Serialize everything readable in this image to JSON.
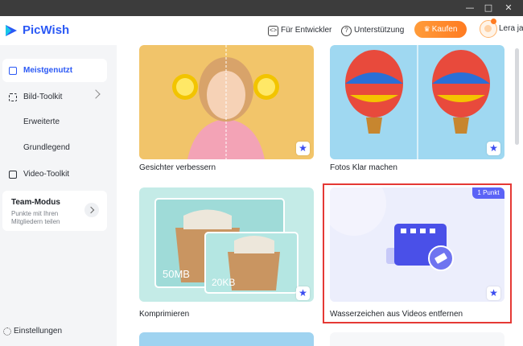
{
  "window": {
    "minimize": "—",
    "maximize": "□",
    "close": "✕"
  },
  "header": {
    "brand": "PicWish",
    "developer_link": "Für Entwickler",
    "support_link": "Unterstützung",
    "buy_button": "Kaufen",
    "username": "Lera ja"
  },
  "sidebar": {
    "items": [
      {
        "label": "Meistgenutzt",
        "active": true
      },
      {
        "label": "Bild-Toolkit"
      },
      {
        "label": "Erweiterte"
      },
      {
        "label": "Grundlegend"
      },
      {
        "label": "Video-Toolkit"
      }
    ],
    "team": {
      "title": "Team-Modus",
      "description": "Punkte mit Ihren Mitgliedern teilen"
    },
    "settings": "Einstellungen"
  },
  "cards": [
    {
      "label": "Gesichter verbessern"
    },
    {
      "label": "Fotos Klar machen"
    },
    {
      "label": "Komprimieren",
      "size_before": "50MB",
      "size_after": "20KB"
    },
    {
      "label": "Wasserzeichen aus Videos entfernen",
      "badge": "1 Punkt"
    }
  ],
  "colors": {
    "accent": "#2b59f5",
    "buy_button": "#ff8a2a",
    "highlight_border": "#e53935",
    "badge": "#5b63f6"
  }
}
